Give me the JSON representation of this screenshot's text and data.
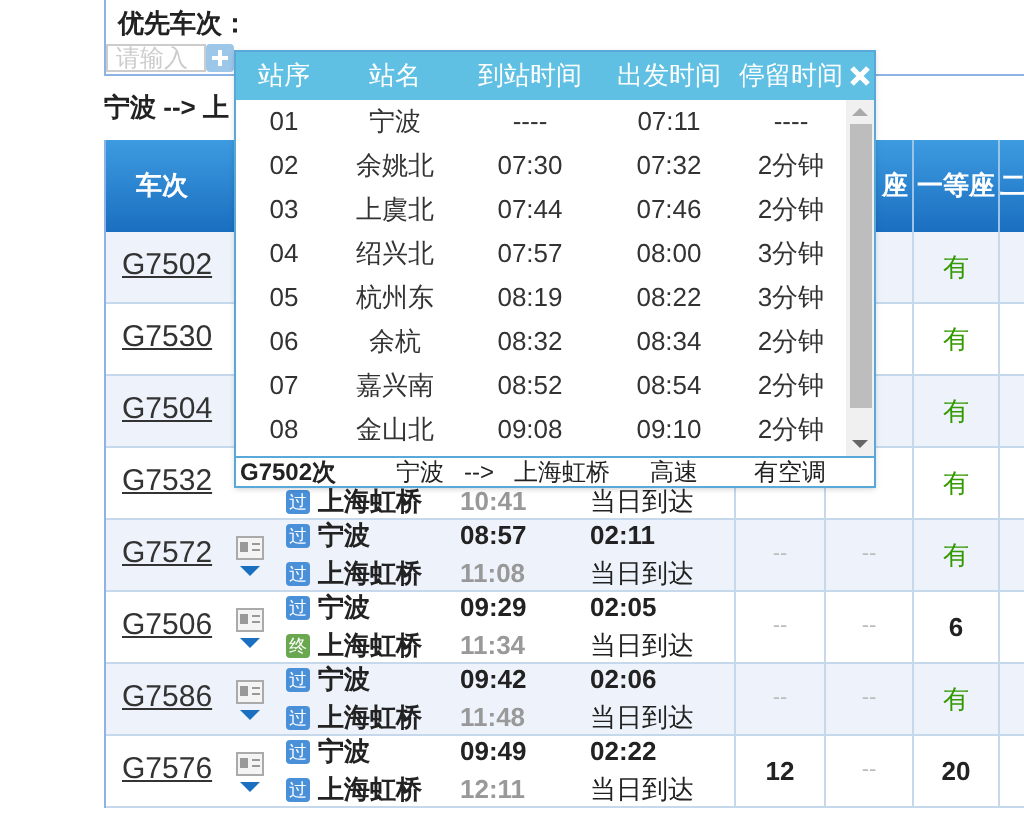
{
  "filter": {
    "label": "优先车次：",
    "input": {
      "placeholder": "请输入"
    }
  },
  "route": "宁波 --> 上",
  "header": {
    "train": "车次",
    "seat_b": "座",
    "seat_c": "一等座",
    "seat_d": "二"
  },
  "rows": [
    {
      "train": "G7502",
      "seat_c": {
        "text": "有",
        "kind": "yes"
      }
    },
    {
      "train": "G7530",
      "seat_c": {
        "text": "有",
        "kind": "yes"
      }
    },
    {
      "train": "G7504",
      "seat_c": {
        "text": "有",
        "kind": "yes"
      }
    },
    {
      "train": "G7532",
      "to": {
        "badge": "过",
        "color": "#4a90d9",
        "name": "上海虹桥"
      },
      "arrive": "10:41",
      "day": "当日到达",
      "seat_c": {
        "text": "有",
        "kind": "yes"
      }
    },
    {
      "train": "G7572",
      "from": {
        "badge": "过",
        "color": "#4a90d9",
        "name": "宁波"
      },
      "to": {
        "badge": "过",
        "color": "#4a90d9",
        "name": "上海虹桥"
      },
      "depart": "08:57",
      "arrive": "11:08",
      "duration": "02:11",
      "day": "当日到达",
      "seat_a": {
        "text": "--",
        "kind": "none"
      },
      "seat_b": {
        "text": "--",
        "kind": "none"
      },
      "seat_c": {
        "text": "有",
        "kind": "yes"
      }
    },
    {
      "train": "G7506",
      "from": {
        "badge": "过",
        "color": "#4a90d9",
        "name": "宁波"
      },
      "to": {
        "badge": "终",
        "color": "#6aa84f",
        "name": "上海虹桥"
      },
      "depart": "09:29",
      "arrive": "11:34",
      "duration": "02:05",
      "day": "当日到达",
      "seat_a": {
        "text": "--",
        "kind": "none"
      },
      "seat_b": {
        "text": "--",
        "kind": "none"
      },
      "seat_c": {
        "text": "6",
        "kind": "count"
      }
    },
    {
      "train": "G7586",
      "from": {
        "badge": "过",
        "color": "#4a90d9",
        "name": "宁波"
      },
      "to": {
        "badge": "过",
        "color": "#4a90d9",
        "name": "上海虹桥"
      },
      "depart": "09:42",
      "arrive": "11:48",
      "duration": "02:06",
      "day": "当日到达",
      "seat_a": {
        "text": "--",
        "kind": "none"
      },
      "seat_b": {
        "text": "--",
        "kind": "none"
      },
      "seat_c": {
        "text": "有",
        "kind": "yes"
      }
    },
    {
      "train": "G7576",
      "from": {
        "badge": "过",
        "color": "#4a90d9",
        "name": "宁波"
      },
      "to": {
        "badge": "过",
        "color": "#4a90d9",
        "name": "上海虹桥"
      },
      "depart": "09:49",
      "arrive": "12:11",
      "duration": "02:22",
      "day": "当日到达",
      "seat_a": {
        "text": "12",
        "kind": "count"
      },
      "seat_b": {
        "text": "--",
        "kind": "none"
      },
      "seat_c": {
        "text": "20",
        "kind": "count"
      }
    }
  ],
  "popup": {
    "columns": [
      "站序",
      "站名",
      "到站时间",
      "出发时间",
      "停留时间"
    ],
    "stops": [
      [
        "01",
        "宁波",
        "----",
        "07:11",
        "----"
      ],
      [
        "02",
        "余姚北",
        "07:30",
        "07:32",
        "2分钟"
      ],
      [
        "03",
        "上虞北",
        "07:44",
        "07:46",
        "2分钟"
      ],
      [
        "04",
        "绍兴北",
        "07:57",
        "08:00",
        "3分钟"
      ],
      [
        "05",
        "杭州东",
        "08:19",
        "08:22",
        "3分钟"
      ],
      [
        "06",
        "余杭",
        "08:32",
        "08:34",
        "2分钟"
      ],
      [
        "07",
        "嘉兴南",
        "08:52",
        "08:54",
        "2分钟"
      ],
      [
        "08",
        "金山北",
        "09:08",
        "09:10",
        "2分钟"
      ]
    ],
    "footer": {
      "train": "G7502次",
      "from": "宁波",
      "arrow": "-->",
      "to": "上海虹桥",
      "type": "高速",
      "extra": "有空调"
    }
  }
}
